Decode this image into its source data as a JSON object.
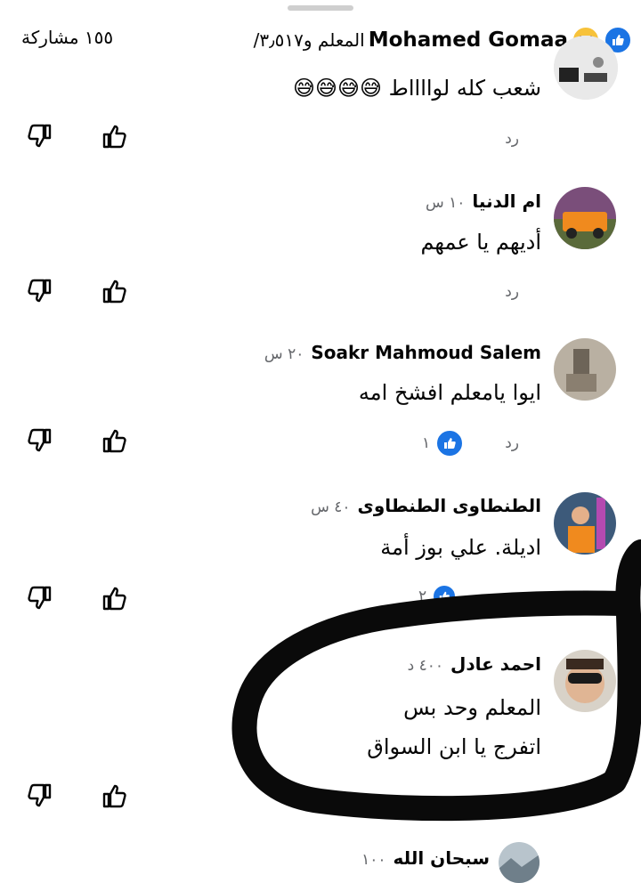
{
  "header": {
    "post_author": "Mohamed Gomaa",
    "reactions_text": "/المعلم و٣٫٥١٧",
    "shares_text": "١٥٥ مشاركة"
  },
  "comments": [
    {
      "name": "",
      "time": "",
      "text": "شعب كله لوااااط 😅😅😅😅",
      "reply": "رد",
      "reactions": ""
    },
    {
      "name": "ام الدنيا",
      "time": "١٠ س",
      "text": "أديهم  يا عمهم",
      "reply": "رد",
      "reactions": ""
    },
    {
      "name": "Soakr Mahmoud Salem",
      "time": "٢٠ س",
      "text": "ايوا يامعلم افشخ امه",
      "reply": "رد",
      "reactions": "١"
    },
    {
      "name": "الطنطاوى الطنطاوى",
      "time": "٤٠ س",
      "text": "اديلة. علي بوز أمة",
      "reply": "",
      "reactions": "٢"
    },
    {
      "name": "احمد عادل",
      "time": "٤٠٠ د",
      "text_line1": "المعلم وحد بس",
      "text_line2": "اتفرج يا ابن السواق",
      "reply": "",
      "reactions": ""
    },
    {
      "name": "سبحان الله",
      "time": "١٠٠",
      "text": "",
      "reply": "",
      "reactions": ""
    }
  ],
  "icons": [
    "like-icon",
    "dislike-icon",
    "haha-emoji-icon",
    "like-badge-icon"
  ],
  "colors": {
    "accent": "#1b74e4",
    "muted": "#65676b",
    "annotation": "#0a0a0a"
  }
}
